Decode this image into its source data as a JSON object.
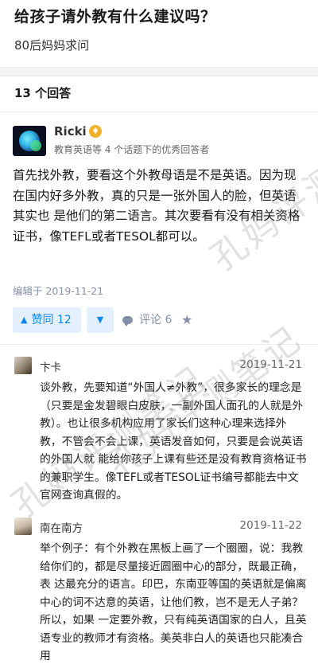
{
  "question": {
    "title": "给孩子请外教有什么建议吗？",
    "subtitle": "80后妈妈求问"
  },
  "answers_count": "13 个回答",
  "answer": {
    "author": {
      "name": "Ricki",
      "badge_icon": "badge-icon",
      "bio": "教育英语等 4 个话题下的优秀回答者"
    },
    "body": "首先找外教，要看这个外教母语是不是英语。因为现在国内好多外教，真的只是一张外国人的脸，但英语其实也 是他们的第二语言。其次要看有没有相关资格证书，像TEFL或者TESOL都可以。",
    "edit_time": "编辑于 2019-11-21",
    "actions": {
      "vote_label": "赞同 12",
      "comment_label": "评论 6"
    }
  },
  "comments": [
    {
      "name": "卞卡",
      "time": "2019-11-21",
      "text": "谈外教，先要知道“外国人≠外教”，很多家长的理念是（只要是金发碧眼白皮肤，一副外国人面孔的人就是外 教）。也让很多机构应用了家长们这种心理来选择外教，不管会不会上课，英语发音如何，只要是会说英语的外国人就 能给你孩子上课有些还是没有教育资格证书的兼职学生。像TEFL或者TESOL证书编号都能去中文官网查询真假的。"
    },
    {
      "name": "南在南方",
      "time": "2019-11-22",
      "text": "举个例子：有个外教在黑板上画了一个圈圈，说：我教给你们的，都是尽量接近圆圈中心的部分，既最正确，表 达最充分的语言。印巴，东南亚等国的英语就是偏离中心的词不达意的英语，让他们教，岂不是无人子弟？所以，如果 一定要外教，只有纯英语国家的白人，且英语专业的教师才有资格。美英非白人的英语也只能凑合用"
    }
  ],
  "watermark": "孔妈评测笔记"
}
